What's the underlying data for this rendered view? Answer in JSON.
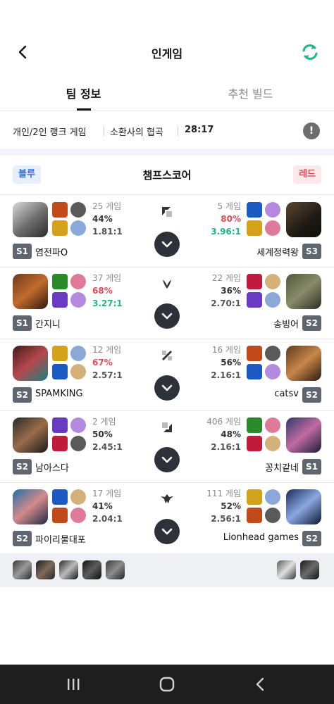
{
  "header": {
    "title": "인게임"
  },
  "tabs": [
    {
      "label": "팀 정보",
      "active": true
    },
    {
      "label": "추천 빌드",
      "active": false
    }
  ],
  "game_info": {
    "queue": "개인/2인 랭크 게임",
    "map": "소환사의 협곡",
    "time": "28:17"
  },
  "score_header": {
    "blue_label": "블루",
    "title": "챔프스코어",
    "red_label": "레드"
  },
  "colors": {
    "blue": "#2f6de3",
    "red": "#e34a55",
    "green": "#1fb68a",
    "accent": "#1fb68a"
  },
  "rows": [
    {
      "lane_icon": "top-lane-icon",
      "blue": {
        "tier": "S1",
        "name": "염전파O",
        "games": "25 게임",
        "wr": "44%",
        "kda": "1.81:1",
        "wr_color": "normal",
        "kda_color": "normal"
      },
      "red": {
        "tier": "S3",
        "name": "세계정력왕",
        "games": "5 게임",
        "wr": "80%",
        "kda": "3.96:1",
        "wr_color": "red",
        "kda_color": "green"
      }
    },
    {
      "lane_icon": "jungle-lane-icon",
      "blue": {
        "tier": "S1",
        "name": "간지니",
        "games": "37 게임",
        "wr": "68%",
        "kda": "3.27:1",
        "wr_color": "red",
        "kda_color": "green"
      },
      "red": {
        "tier": "S2",
        "name": "송빙어",
        "games": "22 게임",
        "wr": "36%",
        "kda": "2.70:1",
        "wr_color": "normal",
        "kda_color": "normal"
      }
    },
    {
      "lane_icon": "mid-lane-icon",
      "blue": {
        "tier": "S2",
        "name": "SPAMKING",
        "games": "12 게임",
        "wr": "67%",
        "kda": "2.57:1",
        "wr_color": "red",
        "kda_color": "normal"
      },
      "red": {
        "tier": "S2",
        "name": "catsv",
        "games": "16 게임",
        "wr": "56%",
        "kda": "2.16:1",
        "wr_color": "normal",
        "kda_color": "normal"
      }
    },
    {
      "lane_icon": "bottom-lane-icon",
      "blue": {
        "tier": "S2",
        "name": "남아스다",
        "games": "2 게임",
        "wr": "50%",
        "kda": "2.45:1",
        "wr_color": "normal",
        "kda_color": "normal"
      },
      "red": {
        "tier": "S1",
        "name": "꽁치같네",
        "games": "406 게임",
        "wr": "48%",
        "kda": "2.16:1",
        "wr_color": "normal",
        "kda_color": "normal"
      }
    },
    {
      "lane_icon": "support-lane-icon",
      "blue": {
        "tier": "S2",
        "name": "파이리물대포",
        "games": "17 게임",
        "wr": "41%",
        "kda": "2.04:1",
        "wr_color": "normal",
        "kda_color": "normal"
      },
      "red": {
        "tier": "S2",
        "name": "Lionhead games",
        "games": "111 게임",
        "wr": "52%",
        "kda": "2.56:1",
        "wr_color": "normal",
        "kda_color": "normal"
      }
    }
  ]
}
